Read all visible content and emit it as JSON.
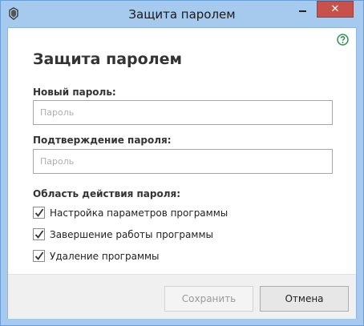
{
  "window": {
    "title": "Защита паролем",
    "close_label": "✕"
  },
  "help": {
    "icon": "question-circle-icon",
    "color": "#2e9b57"
  },
  "dialog": {
    "heading": "Защита паролем",
    "new_password_label": "Новый пароль:",
    "new_password_placeholder": "Пароль",
    "new_password_value": "",
    "confirm_password_label": "Подтверждение пароля:",
    "confirm_password_placeholder": "Пароль",
    "confirm_password_value": "",
    "scope_label": "Область действия пароля:",
    "scope_items": [
      {
        "label": "Настройка параметров программы",
        "checked": true
      },
      {
        "label": "Завершение работы программы",
        "checked": true
      },
      {
        "label": "Удаление программы",
        "checked": true
      }
    ]
  },
  "buttons": {
    "save_label": "Сохранить",
    "save_enabled": false,
    "cancel_label": "Отмена"
  },
  "colors": {
    "close_button": "#c7524b",
    "titlebar": "#a6c9ee",
    "help_icon": "#2e9b57"
  }
}
